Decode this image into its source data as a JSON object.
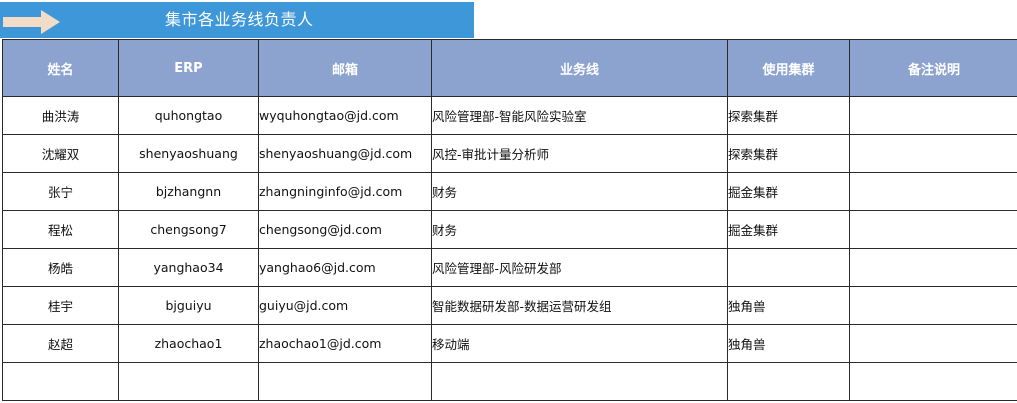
{
  "banner": {
    "title": "集市各业务线负责人",
    "arrow_icon": "arrow-right-icon",
    "background": "#3d97d9"
  },
  "table": {
    "header_background": "#8ca3cf",
    "columns": [
      "姓名",
      "ERP",
      "邮箱",
      "业务线",
      "使用集群",
      "备注说明"
    ],
    "rows": [
      {
        "name": "曲洪涛",
        "erp": "quhongtao",
        "email": "wyquhongtao@jd.com",
        "email_link": true,
        "business_line": "风险管理部-智能风险实验室",
        "cluster": "探索集群",
        "note": ""
      },
      {
        "name": "沈耀双",
        "erp": "shenyaoshuang",
        "email": "shenyaoshuang@jd.com",
        "email_link": true,
        "business_line": "风控-审批计量分析师",
        "cluster": "探索集群",
        "note": ""
      },
      {
        "name": "张宁",
        "erp": "bjzhangnn",
        "email": "zhangninginfo@jd.com",
        "email_link": false,
        "business_line": "财务",
        "cluster": "掘金集群",
        "note": ""
      },
      {
        "name": "程松",
        "erp": "chengsong7",
        "email": "chengsong@jd.com",
        "email_link": false,
        "business_line": "财务",
        "cluster": "掘金集群",
        "note": ""
      },
      {
        "name": "杨皓",
        "erp": "yanghao34",
        "email": "yanghao6@jd.com",
        "email_link": true,
        "business_line": "风险管理部-风险研发部",
        "cluster": "",
        "note": ""
      },
      {
        "name": "桂宇",
        "erp": "bjguiyu",
        "email": "guiyu@jd.com",
        "email_link": true,
        "business_line": "智能数据研发部-数据运营研发组",
        "cluster": "独角兽",
        "note": ""
      },
      {
        "name": "赵超",
        "erp": "zhaochao1",
        "email": "zhaochao1@jd.com",
        "email_link": true,
        "business_line": "移动端",
        "cluster": "独角兽",
        "note": ""
      },
      {
        "name": "",
        "erp": "",
        "email": "",
        "email_link": false,
        "business_line": "",
        "cluster": "",
        "note": ""
      }
    ]
  }
}
